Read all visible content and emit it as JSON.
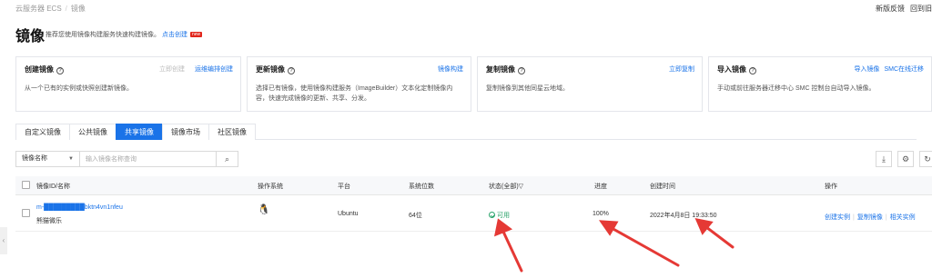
{
  "breadcrumb": {
    "items": [
      "云服务器 ECS",
      "镜像"
    ]
  },
  "top_links": {
    "feedback": "新版反馈",
    "back": "回到旧"
  },
  "header": {
    "title": "镜像",
    "subtitle": "推荐您使用镜像构建服务快速构建镜像。",
    "subtitle_link": "点击创建",
    "badge": "new"
  },
  "cards": [
    {
      "title": "创建镜像",
      "links_disabled": [
        "立即创建"
      ],
      "links": [
        "运维编排创建"
      ],
      "desc": "从一个已有的实例或快照创建新镜像。"
    },
    {
      "title": "更新镜像",
      "links_disabled": [],
      "links": [
        "镜像构建"
      ],
      "desc": "选择已有镜像，使用镜像构建服务（ImageBuilder）文本化定制镜像内容，快速完成镜像的更新、共享、分发。"
    },
    {
      "title": "复制镜像",
      "links_disabled": [],
      "links": [
        "立即复制"
      ],
      "desc": "复制镜像到其他同星云地域。"
    },
    {
      "title": "导入镜像",
      "links_disabled": [],
      "links": [
        "导入镜像",
        "SMC在线迁移"
      ],
      "desc": "手动或前往服务器迁移中心 SMC 控制台自动导入镜像。"
    }
  ],
  "tabs": [
    "自定义镜像",
    "公共镜像",
    "共享镜像",
    "镜像市场",
    "社区镜像"
  ],
  "active_tab": 2,
  "search": {
    "field": "镜像名称",
    "placeholder": "输入镜像名称查询"
  },
  "table": {
    "columns": [
      "镜像ID/名称",
      "操作系统",
      "平台",
      "系统位数",
      "状态(全部)",
      "进度",
      "创建时间",
      "操作"
    ],
    "rows": [
      {
        "id": "m-█████████bktn4vn1nfeu",
        "name": "熊猫微乐",
        "platform": "Ubuntu",
        "bits": "64位",
        "status": "可用",
        "progress": "100%",
        "created": "2022年4月8日 19:33:50",
        "actions": [
          "创建实例",
          "复制镜像",
          "相关实例"
        ]
      }
    ]
  },
  "colors": {
    "accent": "#1a73e8",
    "ok": "#2aa36a",
    "annotation_arrow": "#e53935",
    "badge": "#e1251b"
  }
}
